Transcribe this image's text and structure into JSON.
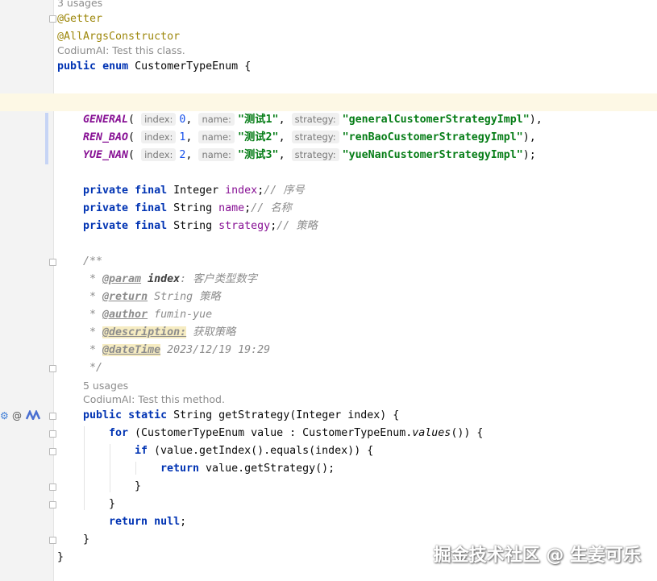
{
  "hints": {
    "usages_top": "3 usages",
    "codium_class": "CodiumAI: Test this class.",
    "usages_method": "5 usages",
    "codium_method": "CodiumAI: Test this method."
  },
  "code": {
    "getter": "@Getter",
    "allargs": "@AllArgsConstructor",
    "kw_public": "public",
    "kw_enum": "enum",
    "enum_decl": " CustomerTypeEnum {",
    "param_index": "index:",
    "param_name": "name:",
    "param_strategy": "strategy:",
    "constants": [
      {
        "name": "GENERAL",
        "index": "0",
        "label": "\"测试1\"",
        "strategy": "\"generalCustomerStrategyImpl\"",
        "end": "),"
      },
      {
        "name": "REN_BAO",
        "index": "1",
        "label": "\"测试2\"",
        "strategy": "\"renBaoCustomerStrategyImpl\"",
        "end": "),"
      },
      {
        "name": "YUE_NAN",
        "index": "2",
        "label": "\"测试3\"",
        "strategy": "\"yueNanCustomerStrategyImpl\"",
        "end": ");"
      }
    ],
    "kw_private": "private",
    "kw_final": "final",
    "fields": [
      {
        "type": " Integer ",
        "name": "index",
        "comment": "// 序号"
      },
      {
        "type": " String ",
        "name": "name",
        "comment": "// 名称"
      },
      {
        "type": " String ",
        "name": "strategy",
        "comment": "// 策略"
      }
    ],
    "javadoc": {
      "open": "/**",
      "param_tag": "@param",
      "param_name": "index",
      "param_desc": ": 客户类型数字",
      "return_tag": "@return",
      "return_desc": " String 策略",
      "author_tag": "@author",
      "author_desc": " fumin-yue",
      "desc_tag": "@description:",
      "desc_desc": " 获取策略",
      "date_tag": "@dateTime",
      "date_desc": " 2023/12/19 19:29",
      "close": " */"
    },
    "kw_static": "static",
    "method_sig": " String getStrategy(Integer index) {",
    "kw_for": "for",
    "for_text": " (CustomerTypeEnum value : CustomerTypeEnum.",
    "for_values": "values",
    "for_end": "()) {",
    "kw_if": "if",
    "if_text": " (value.getIndex().equals(index)) {",
    "kw_return": "return",
    "return_text": " value.getStrategy();",
    "close_brace": "}",
    "return_null_text": ";",
    "kw_null": "null"
  },
  "gutter_icons": [
    "codium-icon",
    "at-icon",
    "ai-assistant-icon"
  ],
  "watermark": "掘金技术社区 @ 生姜可乐",
  "colors": {
    "keyword": "#0033b3",
    "annotation": "#9e880d",
    "string": "#067d17",
    "number": "#1750eb",
    "field": "#871094",
    "comment": "#8c8c8c",
    "current_line": "#fdf8e5"
  }
}
